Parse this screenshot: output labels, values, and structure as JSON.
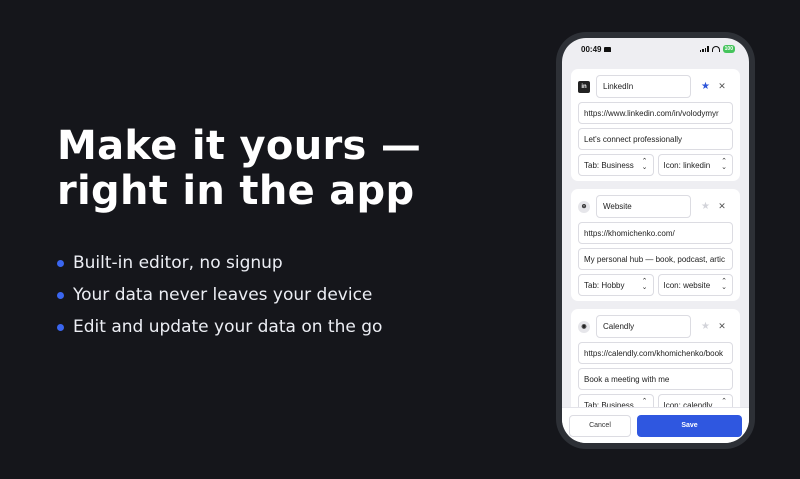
{
  "hero": {
    "title_line1": "Make it yours —",
    "title_line2": "right in the app",
    "bullets": [
      "Built-in editor, no signup",
      "Your data never leaves your device",
      "Edit and update your data on the go"
    ]
  },
  "status_bar": {
    "time": "00:49",
    "battery": "100"
  },
  "cards": [
    {
      "icon": "linkedin-icon",
      "icon_text": "in",
      "name": "LinkedIn",
      "url": "https://www.linkedin.com/in/volodymyr",
      "description": "Let's connect professionally",
      "tab": "Tab: Business",
      "icon_select": "Icon: linkedin",
      "starred": true
    },
    {
      "icon": "globe-icon",
      "icon_text": "⊕",
      "name": "Website",
      "url": "https://khomichenko.com/",
      "description": "My personal hub — book, podcast, artic",
      "tab": "Tab: Hobby",
      "icon_select": "Icon: website",
      "starred": false
    },
    {
      "icon": "calendly-icon",
      "icon_text": "◉",
      "name": "Calendly",
      "url": "https://calendly.com/khomichenko/book",
      "description": "Book a meeting with me",
      "tab": "Tab: Business",
      "icon_select": "Icon: calendly",
      "starred": false
    }
  ],
  "footer": {
    "cancel_label": "Cancel",
    "save_label": "Save"
  },
  "colors": {
    "background": "#15161b",
    "accent": "#2f57e0",
    "bullet_dot": "#3a66f0"
  }
}
